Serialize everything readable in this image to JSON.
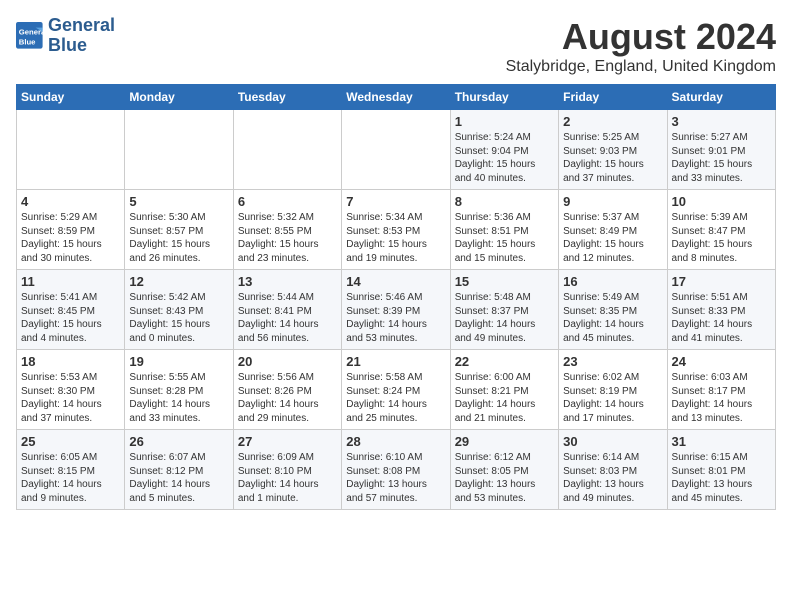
{
  "logo": {
    "line1": "General",
    "line2": "Blue"
  },
  "title": "August 2024",
  "subtitle": "Stalybridge, England, United Kingdom",
  "headers": [
    "Sunday",
    "Monday",
    "Tuesday",
    "Wednesday",
    "Thursday",
    "Friday",
    "Saturday"
  ],
  "weeks": [
    [
      {
        "day": "",
        "info": ""
      },
      {
        "day": "",
        "info": ""
      },
      {
        "day": "",
        "info": ""
      },
      {
        "day": "",
        "info": ""
      },
      {
        "day": "1",
        "info": "Sunrise: 5:24 AM\nSunset: 9:04 PM\nDaylight: 15 hours\nand 40 minutes."
      },
      {
        "day": "2",
        "info": "Sunrise: 5:25 AM\nSunset: 9:03 PM\nDaylight: 15 hours\nand 37 minutes."
      },
      {
        "day": "3",
        "info": "Sunrise: 5:27 AM\nSunset: 9:01 PM\nDaylight: 15 hours\nand 33 minutes."
      }
    ],
    [
      {
        "day": "4",
        "info": "Sunrise: 5:29 AM\nSunset: 8:59 PM\nDaylight: 15 hours\nand 30 minutes."
      },
      {
        "day": "5",
        "info": "Sunrise: 5:30 AM\nSunset: 8:57 PM\nDaylight: 15 hours\nand 26 minutes."
      },
      {
        "day": "6",
        "info": "Sunrise: 5:32 AM\nSunset: 8:55 PM\nDaylight: 15 hours\nand 23 minutes."
      },
      {
        "day": "7",
        "info": "Sunrise: 5:34 AM\nSunset: 8:53 PM\nDaylight: 15 hours\nand 19 minutes."
      },
      {
        "day": "8",
        "info": "Sunrise: 5:36 AM\nSunset: 8:51 PM\nDaylight: 15 hours\nand 15 minutes."
      },
      {
        "day": "9",
        "info": "Sunrise: 5:37 AM\nSunset: 8:49 PM\nDaylight: 15 hours\nand 12 minutes."
      },
      {
        "day": "10",
        "info": "Sunrise: 5:39 AM\nSunset: 8:47 PM\nDaylight: 15 hours\nand 8 minutes."
      }
    ],
    [
      {
        "day": "11",
        "info": "Sunrise: 5:41 AM\nSunset: 8:45 PM\nDaylight: 15 hours\nand 4 minutes."
      },
      {
        "day": "12",
        "info": "Sunrise: 5:42 AM\nSunset: 8:43 PM\nDaylight: 15 hours\nand 0 minutes."
      },
      {
        "day": "13",
        "info": "Sunrise: 5:44 AM\nSunset: 8:41 PM\nDaylight: 14 hours\nand 56 minutes."
      },
      {
        "day": "14",
        "info": "Sunrise: 5:46 AM\nSunset: 8:39 PM\nDaylight: 14 hours\nand 53 minutes."
      },
      {
        "day": "15",
        "info": "Sunrise: 5:48 AM\nSunset: 8:37 PM\nDaylight: 14 hours\nand 49 minutes."
      },
      {
        "day": "16",
        "info": "Sunrise: 5:49 AM\nSunset: 8:35 PM\nDaylight: 14 hours\nand 45 minutes."
      },
      {
        "day": "17",
        "info": "Sunrise: 5:51 AM\nSunset: 8:33 PM\nDaylight: 14 hours\nand 41 minutes."
      }
    ],
    [
      {
        "day": "18",
        "info": "Sunrise: 5:53 AM\nSunset: 8:30 PM\nDaylight: 14 hours\nand 37 minutes."
      },
      {
        "day": "19",
        "info": "Sunrise: 5:55 AM\nSunset: 8:28 PM\nDaylight: 14 hours\nand 33 minutes."
      },
      {
        "day": "20",
        "info": "Sunrise: 5:56 AM\nSunset: 8:26 PM\nDaylight: 14 hours\nand 29 minutes."
      },
      {
        "day": "21",
        "info": "Sunrise: 5:58 AM\nSunset: 8:24 PM\nDaylight: 14 hours\nand 25 minutes."
      },
      {
        "day": "22",
        "info": "Sunrise: 6:00 AM\nSunset: 8:21 PM\nDaylight: 14 hours\nand 21 minutes."
      },
      {
        "day": "23",
        "info": "Sunrise: 6:02 AM\nSunset: 8:19 PM\nDaylight: 14 hours\nand 17 minutes."
      },
      {
        "day": "24",
        "info": "Sunrise: 6:03 AM\nSunset: 8:17 PM\nDaylight: 14 hours\nand 13 minutes."
      }
    ],
    [
      {
        "day": "25",
        "info": "Sunrise: 6:05 AM\nSunset: 8:15 PM\nDaylight: 14 hours\nand 9 minutes."
      },
      {
        "day": "26",
        "info": "Sunrise: 6:07 AM\nSunset: 8:12 PM\nDaylight: 14 hours\nand 5 minutes."
      },
      {
        "day": "27",
        "info": "Sunrise: 6:09 AM\nSunset: 8:10 PM\nDaylight: 14 hours\nand 1 minute."
      },
      {
        "day": "28",
        "info": "Sunrise: 6:10 AM\nSunset: 8:08 PM\nDaylight: 13 hours\nand 57 minutes."
      },
      {
        "day": "29",
        "info": "Sunrise: 6:12 AM\nSunset: 8:05 PM\nDaylight: 13 hours\nand 53 minutes."
      },
      {
        "day": "30",
        "info": "Sunrise: 6:14 AM\nSunset: 8:03 PM\nDaylight: 13 hours\nand 49 minutes."
      },
      {
        "day": "31",
        "info": "Sunrise: 6:15 AM\nSunset: 8:01 PM\nDaylight: 13 hours\nand 45 minutes."
      }
    ]
  ]
}
